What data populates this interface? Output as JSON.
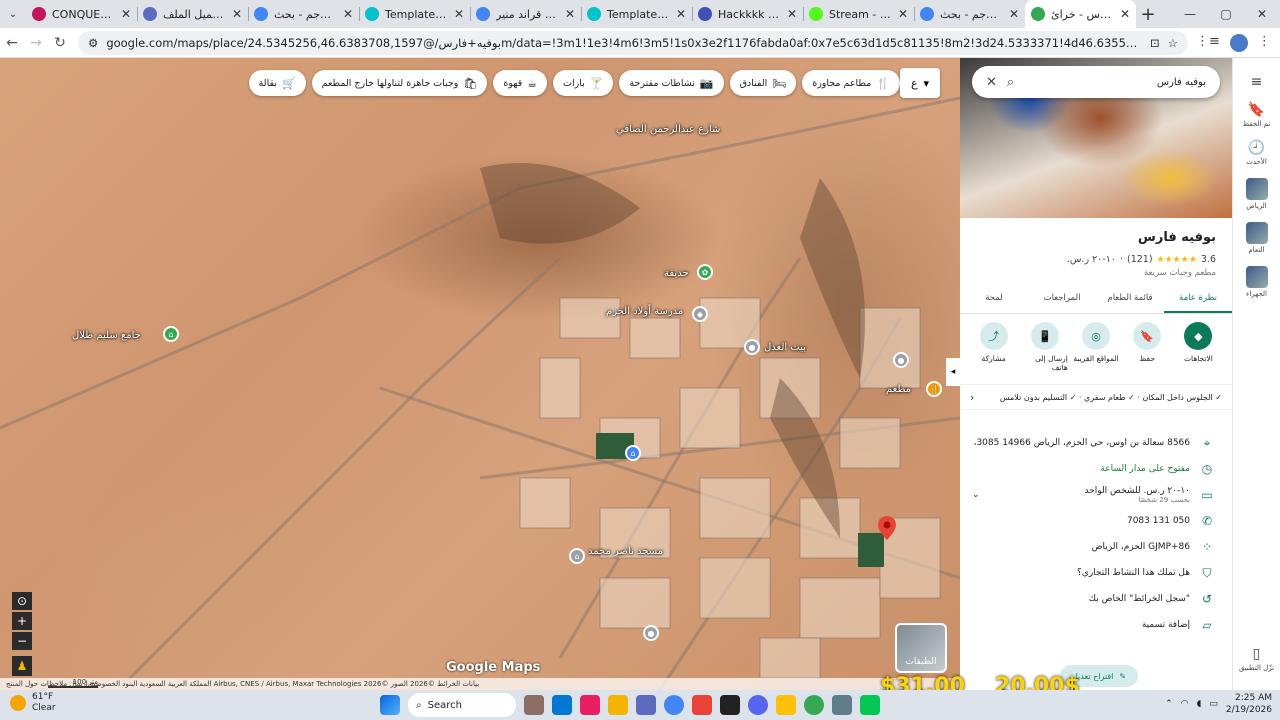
{
  "browser": {
    "tabs": [
      {
        "title": "CONQUER - RMO",
        "color": "#c2185b",
        "active": false
      },
      {
        "title": "تحميل الملف | IMG",
        "color": "#5c6bc0",
        "active": false
      },
      {
        "title": "مترجم - بحث Google",
        "color": "#4285f4",
        "active": false
      },
      {
        "title": "Templates - Canva",
        "color": "#00c4cc",
        "active": false
      },
      {
        "title": "ايم بوت قراند منير",
        "color": "#4285f4",
        "active": false
      },
      {
        "title": "Templates - Canva",
        "color": "#00c4cc",
        "active": false
      },
      {
        "title": "Hackkkk - Presen",
        "color": "#3f51b5",
        "active": false
      },
      {
        "title": "Stream - Kick Das",
        "color": "#53fc18",
        "active": false
      },
      {
        "title": "مترجم - بحث Google",
        "color": "#4285f4",
        "active": false
      },
      {
        "title": "بوفيه فارس - خرائ",
        "color": "#34a853",
        "active": true
      }
    ],
    "url": "google.com/maps/place/بوفيه+فارس/@24.5345256,46.6383708,1597m/data=!3m1!1e3!4m6!3m5!1s0x3e2f1176fabda0af:0x7e5c63d1d5c81135!8m2!3d24.5333371!4d46.635541!16s%2Fg%2F11rwkrhcyh?entry=ttu&g_ep=EgoyMDI2MDIxNi4..."
  },
  "map": {
    "chips": [
      {
        "icon": "🛒",
        "label": "بقالة"
      },
      {
        "icon": "🛍",
        "label": "وجبات جاهزة لتناولها خارج المطعم"
      },
      {
        "icon": "☕",
        "label": "قهوة"
      },
      {
        "icon": "🍸",
        "label": "بارات"
      },
      {
        "icon": "📷",
        "label": "نشاطات مقترحة"
      },
      {
        "icon": "🛏",
        "label": "الفنادق"
      },
      {
        "icon": "🍴",
        "label": "مطاعم مجاورة"
      }
    ],
    "lang_btn": "ع",
    "pins": [
      {
        "label": "حديقة",
        "color": "#34a853"
      },
      {
        "label": "جامع سليم طلال",
        "color": "#34a853"
      },
      {
        "label": "مدرسة أولاد الحزم",
        "color": "#9aa0a6"
      },
      {
        "label": "بيت العدل",
        "color": "#9aa0a6"
      },
      {
        "label": "مسجد ناصر محمد",
        "color": "#9aa0a6"
      },
      {
        "label": "مطعم",
        "color": "#f29900"
      }
    ],
    "street_label": "شارع عبدالرحمن الصافي",
    "layers_label": "الطبقات",
    "google_logo": "Google Maps",
    "footer": "بيانات الخرائط ©2026 الصور ©2026 Airbus, CNES / Airbus, Maxar Technologies   المملكة العربية السعودية   البنود   الخصوصية   إرسال ملاحظات حول المنتج",
    "scale": "100 متر"
  },
  "panel": {
    "search_query": "بوفيه فارس",
    "title": "بوفيه فارس",
    "rating": "3.6",
    "stars": "★★★★★",
    "review_count": "(121)",
    "price": "١٠-٢٠ ر.س.",
    "category": "مطعم وجبات سريعة",
    "tabs": [
      "نظرة عامة",
      "قائمة الطعام",
      "المراجعات",
      "لمحة"
    ],
    "actions": [
      {
        "icon": "◆",
        "label": "الاتجاهات"
      },
      {
        "icon": "🔖",
        "label": "حفظ"
      },
      {
        "icon": "◎",
        "label": "المواقع القريبة"
      },
      {
        "icon": "📱",
        "label": "إرسال إلى هاتف"
      },
      {
        "icon": "⤴",
        "label": "مشاركة"
      }
    ],
    "attributes": "✓ الجلوس داخل المكان · ✓ طعام سفري · ✓ التسليم بدون تلامس",
    "address": "8566 سعالة بن اوس، حي الحزم، الرياض 14966 3085،",
    "hours": "مفتوح على مدار الساعة",
    "price_per_person": "١٠-٢٠ ر.س. للشخص الواحد",
    "price_reported_by": "بحسب 29 شخصًا",
    "phone": "050 131 7083",
    "plus_code": "GJMP+86 الحزم، الرياض",
    "claim": "هل تملك هذا النشاط التجاري؟",
    "history": "\"سجل الخرائط\" الخاص بك",
    "add_label": "إضافة تسمية",
    "suggest_edit": "اقتراح تعديل"
  },
  "rail": {
    "items": [
      {
        "icon": "🔖",
        "label": "تم الحفظ"
      },
      {
        "icon": "🕘",
        "label": "الأحدث"
      },
      {
        "icon": "",
        "label": "الرياض"
      },
      {
        "icon": "",
        "label": "النعام"
      },
      {
        "icon": "",
        "label": "الجهراء"
      }
    ],
    "bottom_label": "نزّل التطبيق"
  },
  "overlay": {
    "price_a": "$31.00",
    "price_b": "20.00$"
  },
  "taskbar": {
    "temp": "61°F",
    "condition": "Clear",
    "search": "Search",
    "time": "2:25 AM",
    "date": "2/19/2026"
  }
}
